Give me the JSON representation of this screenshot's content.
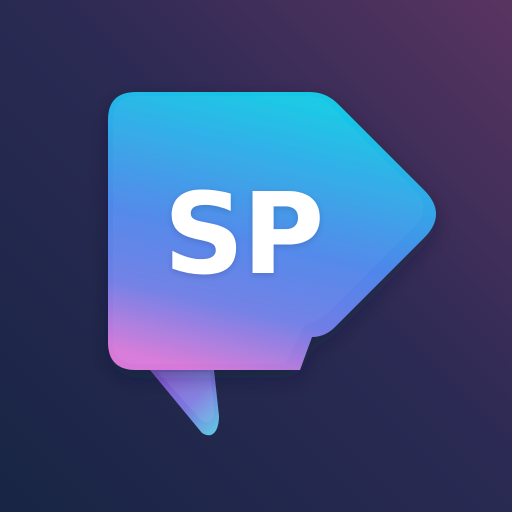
{
  "app_icon": {
    "monogram": "SP",
    "icon_name": "speech-bubble-arrow-logo",
    "colors": {
      "background_dark": "#182544",
      "background_purple": "#5a3461",
      "bubble_cyan": "#14c8e6",
      "bubble_blue": "#4f86ea",
      "bubble_pink": "#d779d8",
      "tail_purple": "#8e56d8",
      "tail_cyan": "#62d5ea",
      "text": "#ffffff"
    }
  }
}
